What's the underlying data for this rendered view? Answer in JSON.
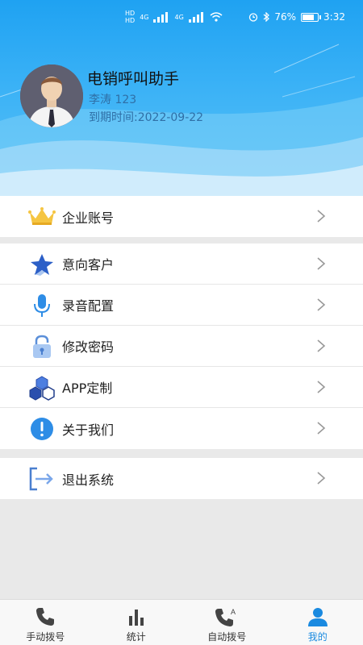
{
  "status_bar": {
    "battery": "76%",
    "time": "3:32",
    "hd1": "HD",
    "hd2": "HD",
    "net1": "4G",
    "net2": "4G"
  },
  "profile": {
    "app_title": "电销呼叫助手",
    "user": "李涛 123",
    "expire": "到期时间:2022-09-22"
  },
  "menu_section_1": [
    {
      "label": "企业账号",
      "icon": "crown-icon"
    }
  ],
  "menu_section_2": [
    {
      "label": "意向客户",
      "icon": "star-icon"
    },
    {
      "label": "录音配置",
      "icon": "microphone-icon"
    },
    {
      "label": "修改密码",
      "icon": "lock-icon"
    },
    {
      "label": "APP定制",
      "icon": "hexagons-icon"
    },
    {
      "label": "关于我们",
      "icon": "info-icon"
    }
  ],
  "menu_section_3": [
    {
      "label": "退出系统",
      "icon": "logout-icon"
    }
  ],
  "tabs": [
    {
      "label": "手动拨号",
      "icon": "phone-icon"
    },
    {
      "label": "统计",
      "icon": "bar-chart-icon"
    },
    {
      "label": "自动拨号",
      "icon": "auto-dial-icon"
    },
    {
      "label": "我的",
      "icon": "person-icon",
      "active": true
    }
  ],
  "colors": {
    "accent": "#1a8ae0",
    "header_top": "#1fa2f2",
    "text_blue": "#2f6fa6"
  }
}
